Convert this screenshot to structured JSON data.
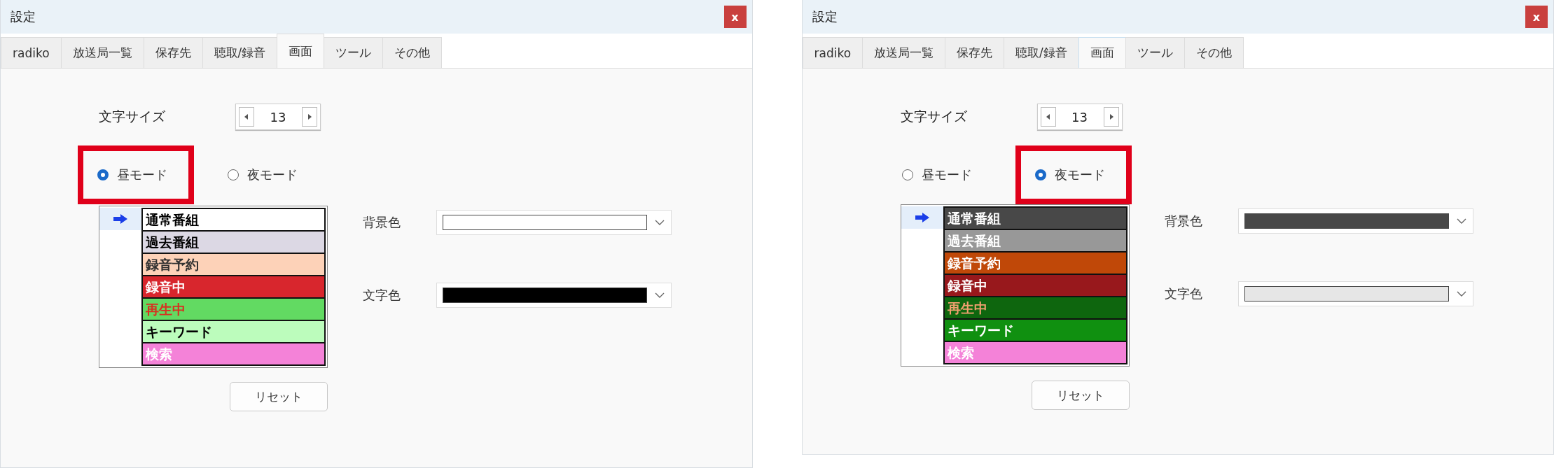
{
  "windows": [
    {
      "title": "設定",
      "close": "x",
      "tabs": [
        {
          "label": "radiko",
          "selected": false
        },
        {
          "label": "放送局一覧",
          "selected": false
        },
        {
          "label": "保存先",
          "selected": false
        },
        {
          "label": "聴取/録音",
          "selected": false
        },
        {
          "label": "画面",
          "selected": true
        },
        {
          "label": "ツール",
          "selected": false
        },
        {
          "label": "その他",
          "selected": false
        }
      ],
      "font_size": {
        "label": "文字サイズ",
        "value": "13"
      },
      "modes": [
        {
          "label": "昼モード",
          "selected": true,
          "highlighted": true
        },
        {
          "label": "夜モード",
          "selected": false,
          "highlighted": false
        }
      ],
      "color_items": [
        {
          "label": "通常番組",
          "color": "#ffffff",
          "font": {
            "color": "#000000"
          },
          "selected": true
        },
        {
          "label": "過去番組",
          "color": "#dcd8e4",
          "font": {
            "color": "#000000"
          },
          "selected": false
        },
        {
          "label": "録音予約",
          "color": "#fdd2b8",
          "font": {
            "color": "#303030"
          },
          "selected": false
        },
        {
          "label": "録音中",
          "color": "#d8262d",
          "font": {
            "color": "#ffffff"
          },
          "selected": false
        },
        {
          "label": "再生中",
          "color": "#62da62",
          "font": {
            "color": "#d83020"
          },
          "selected": false
        },
        {
          "label": "キーワード",
          "color": "#bcfcbc",
          "font": {
            "color": "#000000"
          },
          "selected": false
        },
        {
          "label": "検索",
          "color": "#f482d8",
          "font": {
            "color": "#ffffff"
          },
          "selected": false
        }
      ],
      "background_color": {
        "label": "背景色",
        "color": "#ffffff"
      },
      "text_color": {
        "label": "文字色",
        "color": "#000000"
      },
      "reset_button": "リセット"
    },
    {
      "title": "設定",
      "close": "x",
      "tabs": [
        {
          "label": "radiko",
          "selected": false
        },
        {
          "label": "放送局一覧",
          "selected": false
        },
        {
          "label": "保存先",
          "selected": false
        },
        {
          "label": "聴取/録音",
          "selected": false
        },
        {
          "label": "画面",
          "selected": true
        },
        {
          "label": "ツール",
          "selected": false
        },
        {
          "label": "その他",
          "selected": false
        }
      ],
      "font_size": {
        "label": "文字サイズ",
        "value": "13"
      },
      "modes": [
        {
          "label": "昼モード",
          "selected": false,
          "highlighted": false
        },
        {
          "label": "夜モード",
          "selected": true,
          "highlighted": true
        }
      ],
      "color_items": [
        {
          "label": "通常番組",
          "color": "#484848",
          "font": {
            "color": "#ffffff"
          },
          "selected": true
        },
        {
          "label": "過去番組",
          "color": "#989898",
          "font": {
            "color": "#ffffff"
          },
          "selected": false
        },
        {
          "label": "録音予約",
          "color": "#c04808",
          "font": {
            "color": "#ffffff"
          },
          "selected": false
        },
        {
          "label": "録音中",
          "color": "#98181c",
          "font": {
            "color": "#ffffff"
          },
          "selected": false
        },
        {
          "label": "再生中",
          "color": "#0e660e",
          "font": {
            "color": "#f0a070"
          },
          "selected": false
        },
        {
          "label": "キーワード",
          "color": "#109010",
          "font": {
            "color": "#ffffff"
          },
          "selected": false
        },
        {
          "label": "検索",
          "color": "#f482d8",
          "font": {
            "color": "#ffffff"
          },
          "selected": false
        }
      ],
      "background_color": {
        "label": "背景色",
        "color": "#484848"
      },
      "text_color": {
        "label": "文字色",
        "color": "#e6e6e6"
      },
      "reset_button": "リセット"
    }
  ]
}
